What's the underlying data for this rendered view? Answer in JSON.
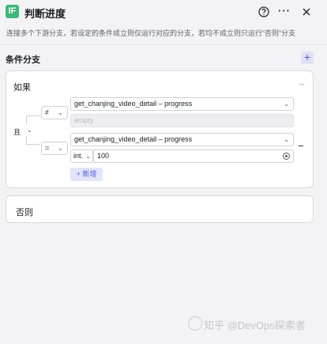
{
  "header": {
    "icon_text": "IF",
    "title": "判断进度",
    "more_label": "···",
    "colors": {
      "icon_bg": "#3db87a",
      "accent": "#4e5bd6"
    }
  },
  "description": "连接多个下游分支，若设定的条件成立则仅运行对应的分支，若均不成立则只运行“否则”分支",
  "section": {
    "title": "条件分支",
    "add_label": "+"
  },
  "if_card": {
    "label": "如果",
    "collapse_label": "−",
    "logic": "且",
    "conditions": [
      {
        "operator": "≠",
        "variable": "get_chanjing_video_detail – progress",
        "value_placeholder": "empty"
      },
      {
        "operator": "=",
        "variable": "get_chanjing_video_detail – progress",
        "value_type": "int.",
        "value": "100",
        "remove_label": "−"
      }
    ],
    "add_condition_label": "+ 新增"
  },
  "else_card": {
    "label": "否则"
  },
  "watermark": "知乎 @DevOps探索者"
}
